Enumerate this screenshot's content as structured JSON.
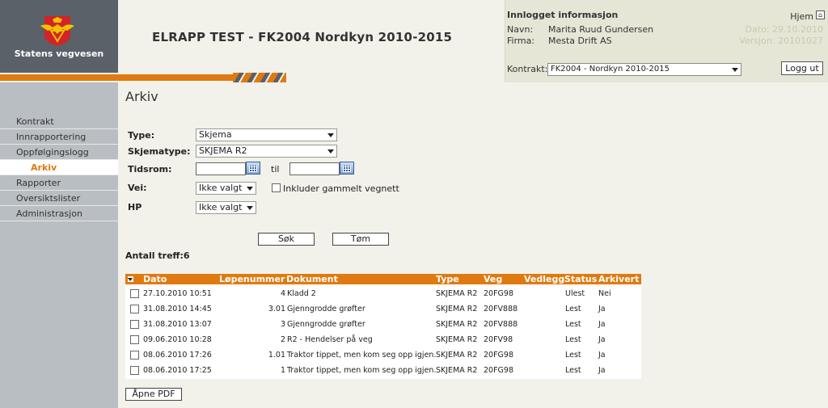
{
  "brand": {
    "name": "Statens vegvesen"
  },
  "header": {
    "title": "ELRAPP TEST - FK2004 Nordkyn 2010-2015"
  },
  "info": {
    "title": "Innlogget informasjon",
    "home": "Hjem",
    "navn_label": "Navn:",
    "navn_value": "Marita Ruud Gundersen",
    "firma_label": "Firma:",
    "firma_value": "Mesta Drift AS",
    "dato": "Dato: 29.10.2010",
    "versjon": "Versjon: 20101027",
    "kontrakt_label": "Kontrakt:",
    "kontrakt_value": "FK2004 - Nordkyn 2010-2015",
    "logout": "Logg ut"
  },
  "sidebar": {
    "items": [
      {
        "label": "Kontrakt"
      },
      {
        "label": "Innrapportering"
      },
      {
        "label": "Oppfølgingslogg"
      },
      {
        "label": "Arkiv"
      },
      {
        "label": "Rapporter"
      },
      {
        "label": "Oversiktslister"
      },
      {
        "label": "Administrasjon"
      }
    ]
  },
  "page": {
    "title": "Arkiv"
  },
  "form": {
    "type_label": "Type:",
    "type_value": "Skjema",
    "skjematype_label": "Skjematype:",
    "skjematype_value": "SKJEMA R2",
    "tidsrom_label": "Tidsrom:",
    "til_label": "til",
    "vei_label": "Vei:",
    "vei_value": "Ikke valgt",
    "include_old": "Inkluder gammelt vegnett",
    "hp_label": "HP",
    "hp_value": "Ikke valgt",
    "search_button": "Søk",
    "clear_button": "Tøm",
    "count_text": "Antall treff:6"
  },
  "table": {
    "headers": {
      "dato": "Dato",
      "lopenummer": "Løpenummer",
      "dokument": "Dokument",
      "type": "Type",
      "veg": "Veg",
      "vedlegg": "Vedlegg",
      "status": "Status",
      "arkivert": "Arkivert"
    },
    "rows": [
      {
        "dato": "27.10.2010 10:51",
        "lopenummer": "4",
        "dokument": "Kladd 2",
        "type": "SKJEMA R2",
        "veg": "20FG98",
        "status": "Ulest",
        "arkivert": "Nei"
      },
      {
        "dato": "31.08.2010 14:45",
        "lopenummer": "3.01",
        "dokument": "Gjenngrodde grøfter",
        "type": "SKJEMA R2",
        "veg": "20FV888",
        "status": "Lest",
        "arkivert": "Ja"
      },
      {
        "dato": "31.08.2010 13:07",
        "lopenummer": "3",
        "dokument": "Gjenngrodde grøfter",
        "type": "SKJEMA R2",
        "veg": "20FV888",
        "status": "Lest",
        "arkivert": "Ja"
      },
      {
        "dato": "09.06.2010 10:28",
        "lopenummer": "2",
        "dokument": "R2 - Hendelser på veg",
        "type": "SKJEMA R2",
        "veg": "20FV98",
        "status": "Lest",
        "arkivert": "Ja"
      },
      {
        "dato": "08.06.2010 17:26",
        "lopenummer": "1.01",
        "dokument": "Traktor tippet, men kom seg opp igjen.",
        "type": "SKJEMA R2",
        "veg": "20FG98",
        "status": "Lest",
        "arkivert": "Ja"
      },
      {
        "dato": "08.06.2010 17:25",
        "lopenummer": "1",
        "dokument": "Traktor tippet, men kom seg opp igjen.",
        "type": "SKJEMA R2",
        "veg": "20FG98",
        "status": "Lest",
        "arkivert": "Ja"
      }
    ]
  },
  "actions": {
    "open_pdf": "Åpne PDF"
  },
  "colors": {
    "accent": "#e07a10",
    "brand_gray": "#5a6168",
    "logo_red": "#d2232a",
    "logo_yellow": "#f3c300"
  }
}
